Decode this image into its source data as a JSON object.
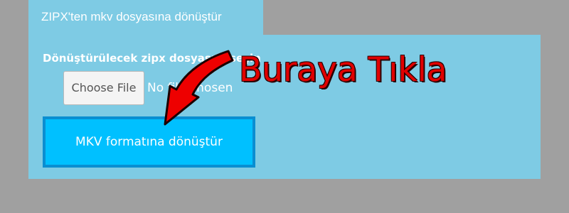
{
  "tab": {
    "title": "ZIPX'ten mkv dosyasına dönüştür"
  },
  "form": {
    "instruction": "Dönüştürülecek zipx dosyasını seçin",
    "choose_file_label": "Choose File",
    "file_status": "No file chosen",
    "convert_label": "MKV formatına dönüştür"
  },
  "annotation": {
    "text": "Buraya Tıkla",
    "color": "#e10000"
  },
  "colors": {
    "panel": "#7ecbe4",
    "background": "#a0a0a0",
    "button": "#00c0ff",
    "button_border": "#0a8ed1"
  }
}
